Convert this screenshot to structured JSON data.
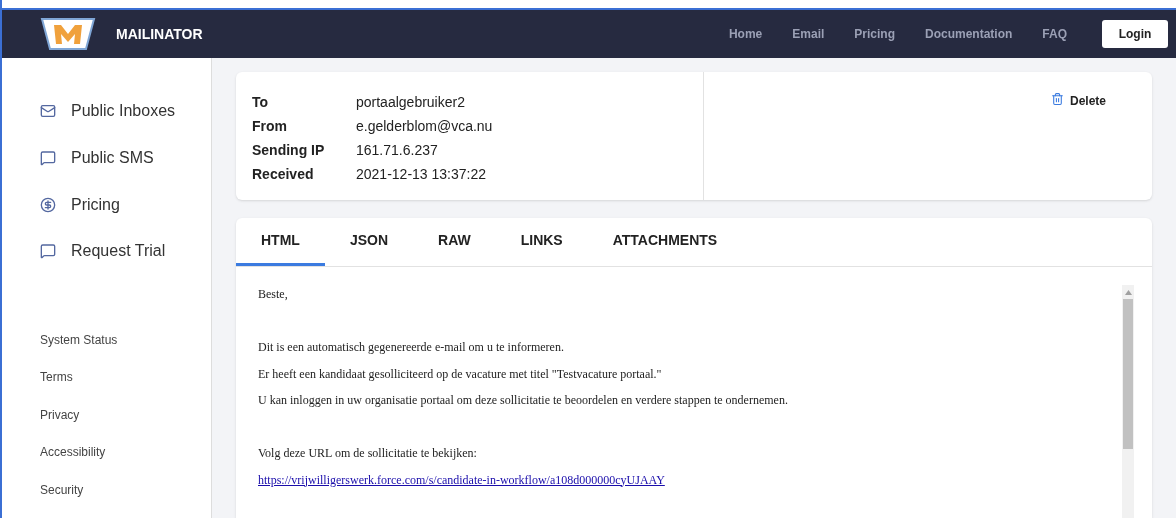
{
  "header": {
    "brand": "MAILINATOR",
    "nav": [
      "Home",
      "Email",
      "Pricing",
      "Documentation",
      "FAQ"
    ],
    "login": "Login"
  },
  "sidebar": {
    "items": [
      {
        "label": "Public Inboxes",
        "kind": "mail"
      },
      {
        "label": "Public SMS",
        "kind": "chat"
      },
      {
        "label": "Pricing",
        "kind": "dollar"
      },
      {
        "label": "Request Trial",
        "kind": "chat"
      }
    ],
    "footer_links": [
      "System Status",
      "Terms",
      "Privacy",
      "Accessibility",
      "Security"
    ]
  },
  "message": {
    "fields": [
      {
        "label": "To",
        "value": "portaalgebruiker2"
      },
      {
        "label": "From",
        "value": "e.gelderblom@vca.nu"
      },
      {
        "label": "Sending IP",
        "value": "161.71.6.237"
      },
      {
        "label": "Received",
        "value": "2021-12-13 13:37:22"
      }
    ],
    "delete": "Delete"
  },
  "tabs": [
    {
      "label": "HTML",
      "selected": true
    },
    {
      "label": "JSON",
      "selected": false
    },
    {
      "label": "RAW",
      "selected": false
    },
    {
      "label": "LINKS",
      "selected": false
    },
    {
      "label": "ATTACHMENTS",
      "selected": false
    }
  ],
  "body": [
    {
      "kind": "text",
      "text": "Beste,"
    },
    {
      "kind": "gap"
    },
    {
      "kind": "text",
      "text": "Dit is een automatisch gegenereerde e-mail om u te informeren."
    },
    {
      "kind": "text",
      "text": "Er heeft een kandidaat gesolliciteerd op de vacature met titel \"Testvacature portaal.\""
    },
    {
      "kind": "text",
      "text": "U kan inloggen in uw organisatie portaal om deze sollicitatie te beoordelen en verdere stappen te ondernemen."
    },
    {
      "kind": "gap"
    },
    {
      "kind": "text",
      "text": "Volg deze URL om de sollicitatie te bekijken:"
    },
    {
      "kind": "link",
      "text": "https://vrijwilligerswerk.force.com/s/candidate-in-workflow/a108d000000cyUJAAY"
    }
  ]
}
